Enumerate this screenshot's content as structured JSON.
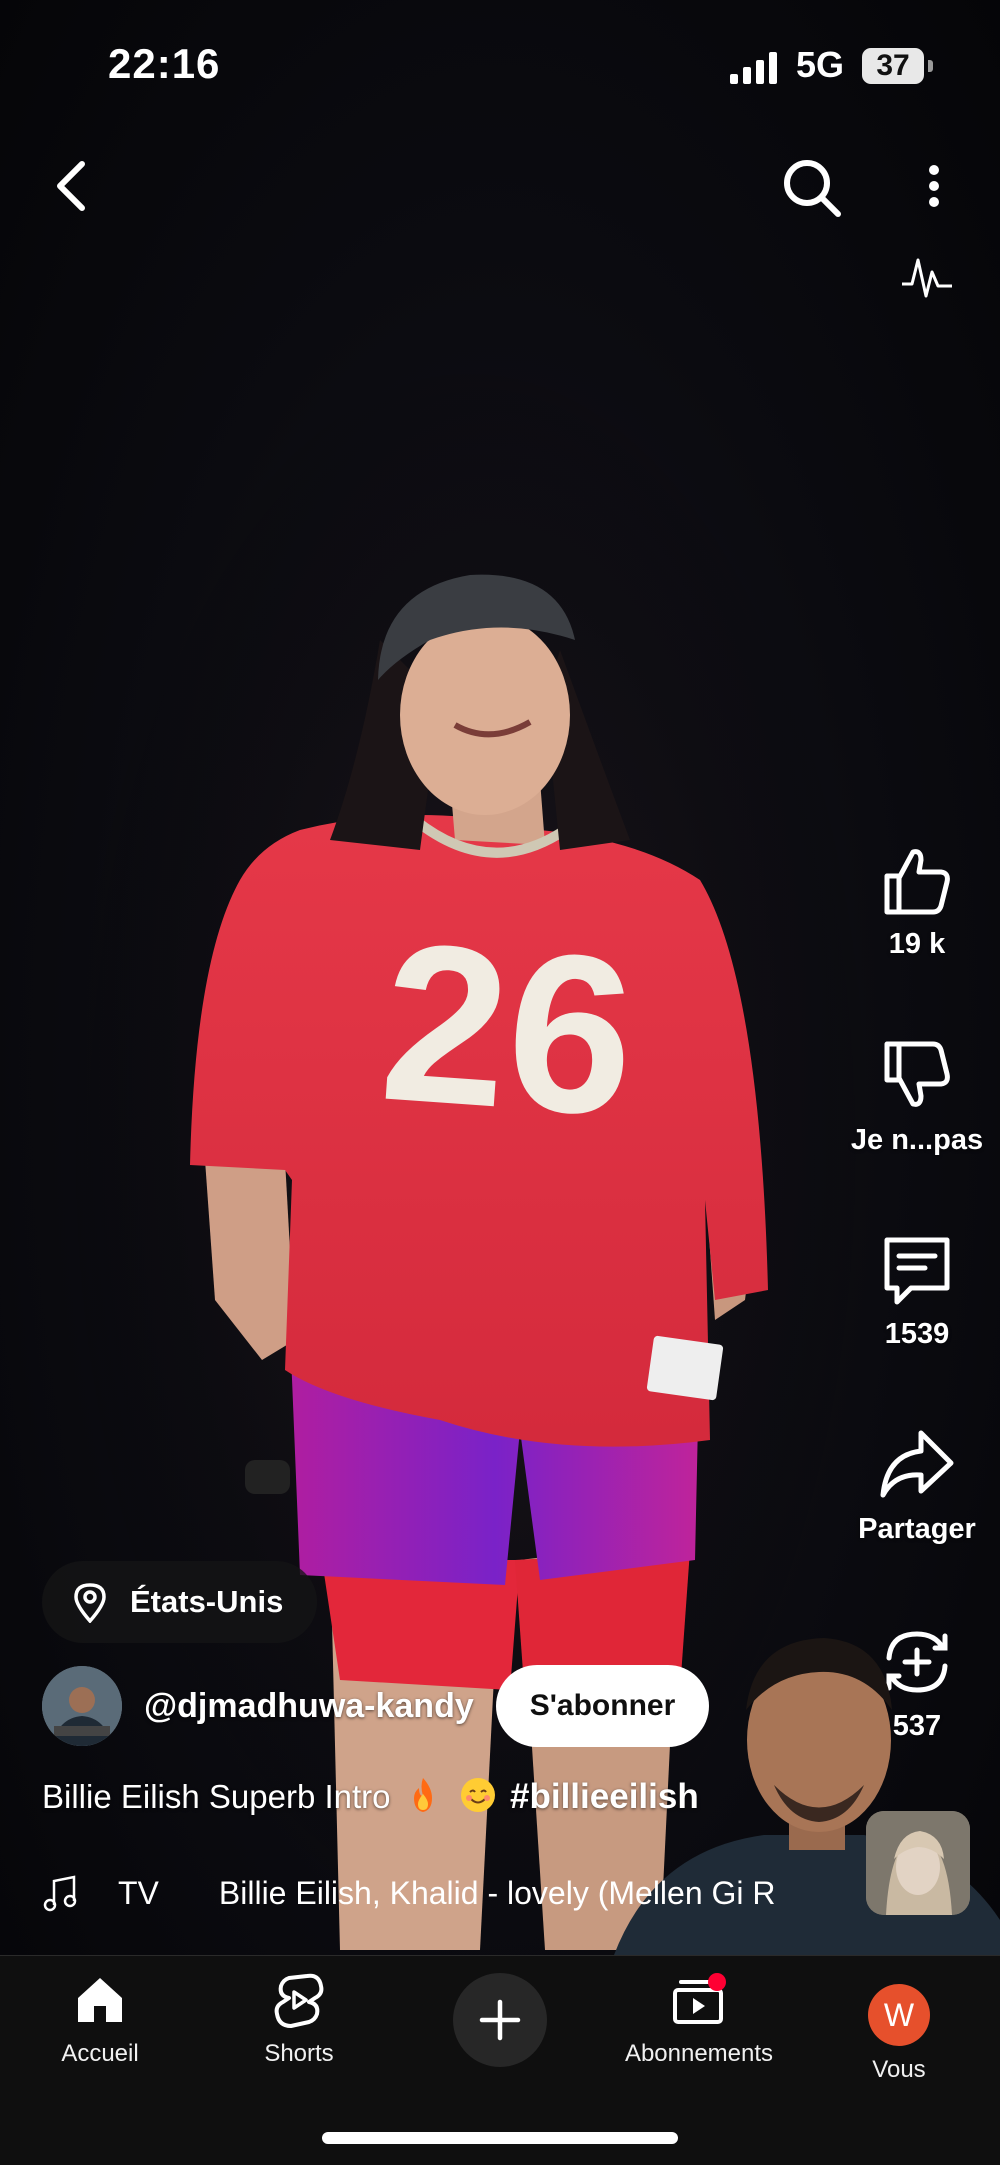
{
  "status_bar": {
    "time": "22:16",
    "network": "5G",
    "battery": "37"
  },
  "top_bar": {
    "back_icon": "chevron-left-icon",
    "search_icon": "search-icon",
    "more_icon": "more-vertical-icon",
    "pulse_icon": "waveform-icon"
  },
  "actions": {
    "like": {
      "icon": "thumbs-up-icon",
      "label": "19 k"
    },
    "dislike": {
      "icon": "thumbs-down-icon",
      "label": "Je n...pas"
    },
    "comment": {
      "icon": "comment-icon",
      "label": "1539"
    },
    "share": {
      "icon": "share-icon",
      "label": "Partager"
    },
    "remix": {
      "icon": "remix-icon",
      "label": "537"
    }
  },
  "video": {
    "location": "États-Unis",
    "channel": "@djmadhuwa-kandy",
    "subscribe_label": "S'abonner",
    "title_text": "Billie Eilish Superb Intro",
    "title_emojis": [
      "fire",
      "smiling-face"
    ],
    "hashtag": "#billieeilish",
    "music_prefix": "TV",
    "music_track": "Billie Eilish, Khalid - lovely (Mellen Gi R"
  },
  "bottom_nav": {
    "items": [
      {
        "label": "Accueil",
        "icon": "home-icon",
        "active": true
      },
      {
        "label": "Shorts",
        "icon": "shorts-icon"
      },
      {
        "label": "",
        "icon": "plus-icon"
      },
      {
        "label": "Abonnements",
        "icon": "subscriptions-icon",
        "has_notification_dot": true
      },
      {
        "label": "Vous",
        "icon": "avatar-icon",
        "avatar_letter": "W"
      }
    ]
  },
  "colors": {
    "background": "#000000",
    "nav_background": "#0f0f0f",
    "subscribe_bg": "#ffffff",
    "notification_dot": "#ff0033",
    "avatar_you": "#e6502c"
  }
}
